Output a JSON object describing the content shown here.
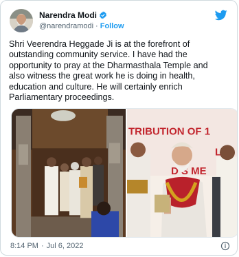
{
  "author": {
    "display_name": "Narendra Modi",
    "handle": "@narendramodi",
    "separator": "·",
    "follow_label": "Follow",
    "avatar_icon": "profile-photo",
    "verified_icon": "verified-badge-icon"
  },
  "tweet": {
    "text": "Shri Veerendra Heggade Ji is at the forefront of\noutstanding community service. I have had the\nopportunity to pray at the Dharmasthala Temple and\nalso witness the great work he is doing in health,\neducation and culture. He will certainly enrich\nParliamentary proceedings.",
    "time": "8:14 PM",
    "separator": "·",
    "date": "Jul 6, 2022"
  },
  "media": {
    "left_banner_fragment": "",
    "right_banner_line1": "TRIBUTION OF 1",
    "right_banner_line2": "LA",
    "right_banner_line3": "D S    ME"
  },
  "colors": {
    "accent": "#1d9bf0",
    "text_primary": "#0f1419",
    "text_secondary": "#536471",
    "border": "#cfd9de"
  },
  "icons": {
    "brand": "twitter-bird-icon",
    "info": "info-circle-icon"
  }
}
